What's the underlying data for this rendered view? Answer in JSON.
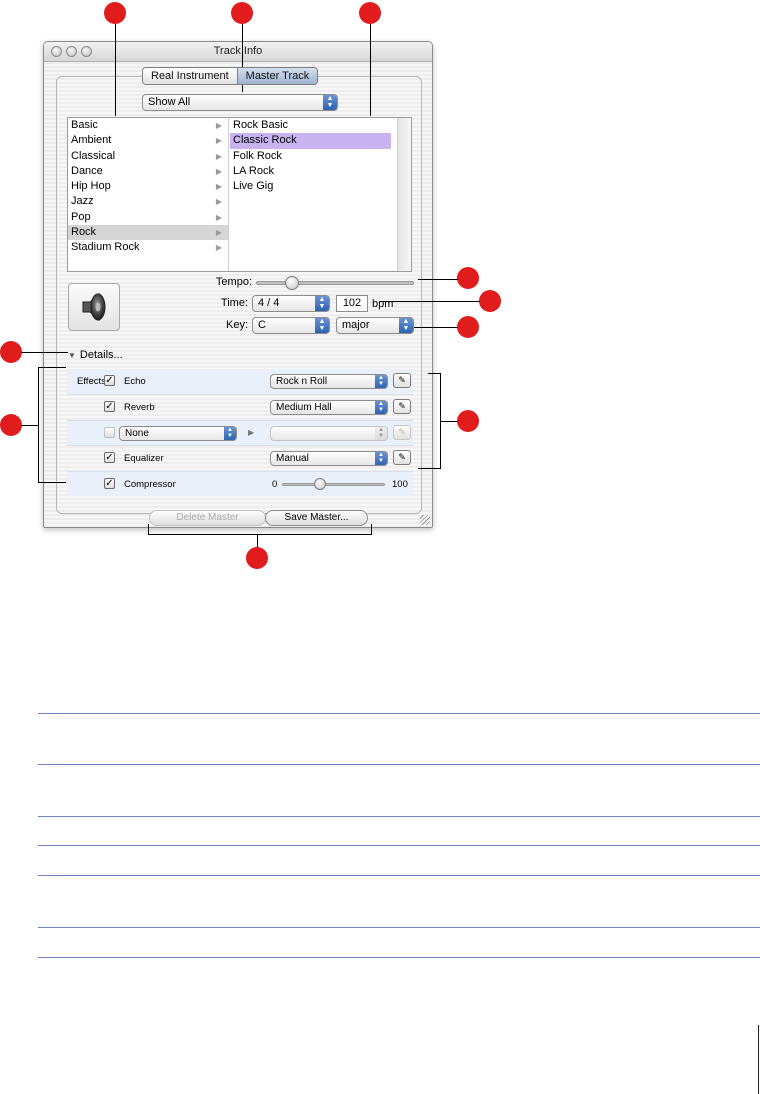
{
  "window": {
    "title": "Track Info",
    "tabs": [
      {
        "label": "Real Instrument",
        "active": false
      },
      {
        "label": "Master Track",
        "active": true
      }
    ]
  },
  "filter": {
    "selected": "Show All"
  },
  "categories": [
    "Basic",
    "Ambient",
    "Classical",
    "Dance",
    "Hip Hop",
    "Jazz",
    "Pop",
    "Rock",
    "Stadium Rock"
  ],
  "selected_category": "Rock",
  "presets": [
    "Rock Basic",
    "Classic Rock",
    "Folk Rock",
    "LA Rock",
    "Live Gig"
  ],
  "selected_preset": "Classic Rock",
  "tempo": {
    "label": "Tempo:",
    "level": 0.23
  },
  "time": {
    "label": "Time:",
    "signature": "4 / 4",
    "bpm": "102",
    "unit": "bpm"
  },
  "key": {
    "label": "Key:",
    "note": "C",
    "mode": "major"
  },
  "details": {
    "label": "Details..."
  },
  "effects": {
    "label": "Effects:",
    "rows": [
      {
        "checked": true,
        "name": "Echo",
        "preset": "Rock n Roll"
      },
      {
        "checked": true,
        "name": "Reverb",
        "preset": "Medium Hall"
      },
      {
        "checked": false,
        "name": "None",
        "preset": "",
        "disabled": true
      },
      {
        "checked": true,
        "name": "Equalizer",
        "preset": "Manual"
      },
      {
        "checked": true,
        "name": "Compressor",
        "slider_min": "0",
        "slider_max": "100",
        "level": 0.37
      }
    ]
  },
  "buttons": {
    "delete": "Delete Master",
    "save": "Save Master..."
  },
  "colors": {
    "callout": "#e01c1c",
    "selection_preset": "#c7b3ef",
    "popup_accent": "#2a5fae",
    "table_rule": "#6c87c2"
  }
}
